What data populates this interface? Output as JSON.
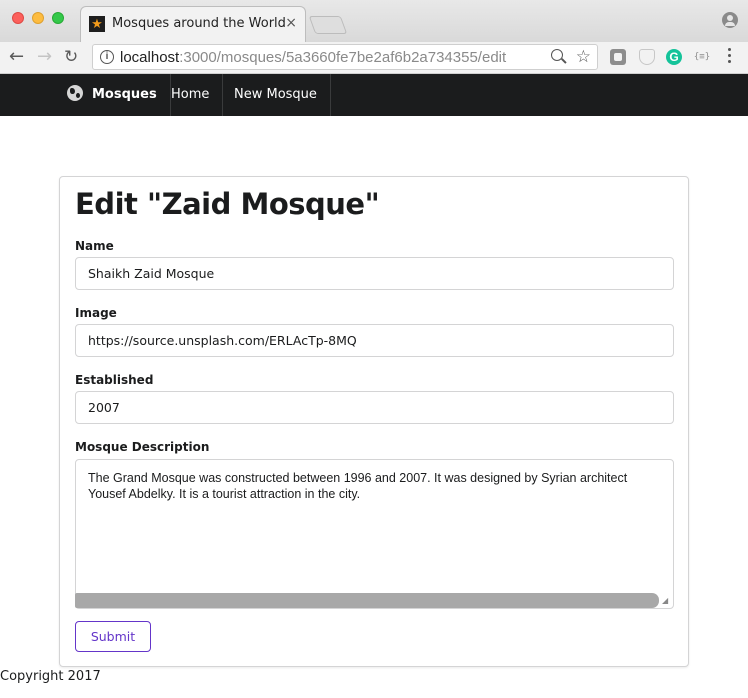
{
  "browser": {
    "tab_title": "Mosques around the World",
    "tab_close": "×",
    "url_host": "localhost",
    "url_path": ":3000/mosques/5a3660fe7be2af6b2a734355/edit",
    "extensions": [
      "extension-square-icon",
      "shield-extension-icon",
      "grammarly-icon",
      "json-viewer-icon"
    ],
    "grammarly_letter": "G",
    "json_ext_label": "{≡}"
  },
  "navbar": {
    "brand": "Mosques",
    "home": "Home",
    "new_mosque": "New Mosque"
  },
  "form": {
    "heading": "Edit \"Zaid Mosque\"",
    "name_label": "Name",
    "name_value": "Shaikh Zaid Mosque",
    "image_label": "Image",
    "image_value": "https://source.unsplash.com/ERLAcTp-8MQ",
    "established_label": "Established",
    "established_value": "2007",
    "description_label": "Mosque Description",
    "description_value": "The Grand Mosque was constructed between 1996 and 2007. It was designed by Syrian architect Yousef Abdelky. It is a tourist attraction in the city.",
    "submit_label": "Submit"
  },
  "footer": {
    "copyright": "Copyright 2017"
  },
  "colors": {
    "navbar_bg": "#1b1c1d",
    "accent": "#6435c9"
  }
}
